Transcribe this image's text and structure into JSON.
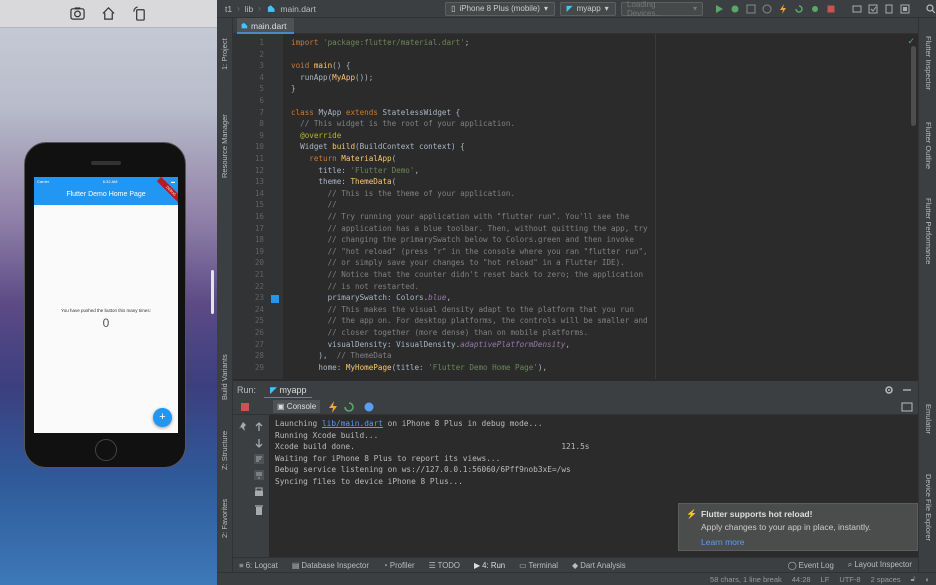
{
  "simulator": {
    "status_time": "6:32 AM",
    "carrier": "Carrier",
    "app_title": "Flutter Demo Home Page",
    "debug_label": "DEBUG",
    "counter_text": "You have pushed the button this many times:",
    "counter_value": "0",
    "fab_label": "+"
  },
  "nav": {
    "breadcrumbs": [
      "t1",
      "lib",
      "main.dart"
    ],
    "device_selector": "iPhone 8 Plus (mobile)",
    "config_selector": "myapp",
    "devices_loading": "Loading Devices..."
  },
  "editor": {
    "tab": "main.dart",
    "lines": [
      {
        "n": "1",
        "t": [
          [
            "kw",
            "import "
          ],
          [
            "str",
            "'package:flutter/material.dart'"
          ],
          [
            "cls",
            ";"
          ]
        ]
      },
      {
        "n": "2",
        "t": []
      },
      {
        "n": "3",
        "t": [
          [
            "kw",
            "void "
          ],
          [
            "fn",
            "main"
          ],
          [
            "cls",
            "() {"
          ]
        ]
      },
      {
        "n": "4",
        "t": [
          [
            "cls",
            "  runApp("
          ],
          [
            "fn",
            "MyApp"
          ],
          [
            "cls",
            "());"
          ]
        ]
      },
      {
        "n": "5",
        "t": [
          [
            "cls",
            "}"
          ]
        ]
      },
      {
        "n": "6",
        "t": []
      },
      {
        "n": "7",
        "t": [
          [
            "kw",
            "class "
          ],
          [
            "cls",
            "MyApp "
          ],
          [
            "kw",
            "extends "
          ],
          [
            "cls",
            "StatelessWidget {"
          ]
        ]
      },
      {
        "n": "8",
        "t": [
          [
            "cmt",
            "  // This widget is the root of your application."
          ]
        ]
      },
      {
        "n": "9",
        "t": [
          [
            "ann",
            "  @override"
          ]
        ]
      },
      {
        "n": "10",
        "t": [
          [
            "cls",
            "  Widget "
          ],
          [
            "fn",
            "build"
          ],
          [
            "cls",
            "(BuildContext context) {"
          ]
        ]
      },
      {
        "n": "11",
        "t": [
          [
            "kw",
            "    return "
          ],
          [
            "fn",
            "MaterialApp"
          ],
          [
            "cls",
            "("
          ]
        ]
      },
      {
        "n": "12",
        "t": [
          [
            "cls",
            "      title: "
          ],
          [
            "str",
            "'Flutter Demo'"
          ],
          [
            "cls",
            ","
          ]
        ]
      },
      {
        "n": "13",
        "t": [
          [
            "cls",
            "      theme: "
          ],
          [
            "fn",
            "ThemeData"
          ],
          [
            "cls",
            "("
          ]
        ]
      },
      {
        "n": "14",
        "t": [
          [
            "cmt",
            "        // This is the theme of your application."
          ]
        ]
      },
      {
        "n": "15",
        "t": [
          [
            "cmt",
            "        //"
          ]
        ]
      },
      {
        "n": "16",
        "t": [
          [
            "cmt",
            "        // Try running your application with \"flutter run\". You'll see the"
          ]
        ]
      },
      {
        "n": "17",
        "t": [
          [
            "cmt",
            "        // application has a blue toolbar. Then, without quitting the app, try"
          ]
        ]
      },
      {
        "n": "18",
        "t": [
          [
            "cmt",
            "        // changing the primarySwatch below to Colors.green and then invoke"
          ]
        ]
      },
      {
        "n": "19",
        "t": [
          [
            "cmt",
            "        // \"hot reload\" (press \"r\" in the console where you ran \"flutter run\","
          ]
        ]
      },
      {
        "n": "20",
        "t": [
          [
            "cmt",
            "        // or simply save your changes to \"hot reload\" in a Flutter IDE)."
          ]
        ]
      },
      {
        "n": "21",
        "t": [
          [
            "cmt",
            "        // Notice that the counter didn't reset back to zero; the application"
          ]
        ]
      },
      {
        "n": "22",
        "t": [
          [
            "cmt",
            "        // is not restarted."
          ]
        ]
      },
      {
        "n": "23",
        "t": [
          [
            "cls",
            "        primarySwatch: Colors."
          ],
          [
            "prop",
            "blue"
          ],
          [
            "cls",
            ","
          ]
        ]
      },
      {
        "n": "24",
        "t": [
          [
            "cmt",
            "        // This makes the visual density adapt to the platform that you run"
          ]
        ]
      },
      {
        "n": "25",
        "t": [
          [
            "cmt",
            "        // the app on. For desktop platforms, the controls will be smaller and"
          ]
        ]
      },
      {
        "n": "26",
        "t": [
          [
            "cmt",
            "        // closer together (more dense) than on mobile platforms."
          ]
        ]
      },
      {
        "n": "27",
        "t": [
          [
            "cls",
            "        visualDensity: VisualDensity."
          ],
          [
            "prop",
            "adaptivePlatformDensity"
          ],
          [
            "cls",
            ","
          ]
        ]
      },
      {
        "n": "28",
        "t": [
          [
            "cls",
            "      ),  "
          ],
          [
            "cmt",
            "// ThemeData"
          ]
        ]
      },
      {
        "n": "29",
        "t": [
          [
            "cls",
            "      home: "
          ],
          [
            "fn",
            "MyHomePage"
          ],
          [
            "cls",
            "(title: "
          ],
          [
            "str",
            "'Flutter Demo Home Page'"
          ],
          [
            "cls",
            "),"
          ]
        ]
      }
    ]
  },
  "run": {
    "label": "Run:",
    "config": "myapp",
    "console_tab": "Console",
    "console_lines": [
      {
        "pre": "Launching ",
        "link": "lib/main.dart",
        "post": " on iPhone 8 Plus in debug mode..."
      },
      {
        "pre": "Running Xcode build...",
        "link": "",
        "post": ""
      },
      {
        "pre": "Xcode build done.                                            121.5s",
        "link": "",
        "post": ""
      },
      {
        "pre": "Waiting for iPhone 8 Plus to report its views...",
        "link": "",
        "post": ""
      },
      {
        "pre": "Debug service listening on ws://127.0.0.1:56060/6Pff9nob3xE=/ws",
        "link": "",
        "post": ""
      },
      {
        "pre": "Syncing files to device iPhone 8 Plus...",
        "link": "",
        "post": ""
      }
    ]
  },
  "notification": {
    "title": "Flutter supports hot reload!",
    "body": "Apply changes to your app in place, instantly.",
    "link": "Learn more"
  },
  "bottom_tabs": [
    "6: Logcat",
    "Database Inspector",
    "Profiler",
    "TODO",
    "4: Run",
    "Terminal",
    "Dart Analysis"
  ],
  "bottom_right_tabs": [
    "Event Log",
    "Layout Inspector"
  ],
  "left_tool_windows": [
    "1: Project",
    "Resource Manager",
    "Build Variants",
    "Z: Structure",
    "2: Favorites"
  ],
  "right_tool_windows": [
    "Flutter Inspector",
    "Flutter Outline",
    "Flutter Performance",
    "Emulator",
    "Device File Explorer"
  ],
  "status": {
    "selection": "58 chars, 1 line break",
    "position": "44:28",
    "line_sep": "LF",
    "encoding": "UTF-8",
    "indent": "2 spaces"
  },
  "colors": {
    "flutter_blue": "#2196f3",
    "link": "#589df6",
    "accent": "#4a88c7"
  }
}
